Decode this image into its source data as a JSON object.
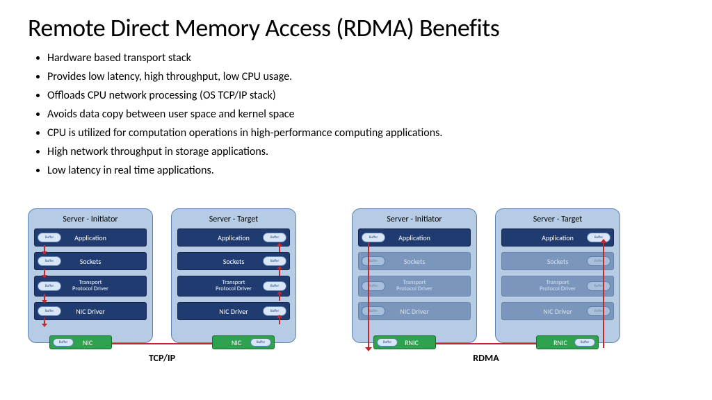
{
  "title": "Remote Direct Memory Access (RDMA) Benefits",
  "bullets": [
    "Hardware based transport stack",
    "Provides low latency, high throughput, low CPU usage.",
    "Offloads CPU network processing (OS TCP/IP stack)",
    "Avoids data copy between user space and kernel space",
    "CPU is utilized for computation operations in high-performance computing applications.",
    "High network throughput in storage applications.",
    "Low latency in real time applications."
  ],
  "buffer_label": "Buffer",
  "servers": {
    "initiator": "Server - Initiator",
    "target": "Server - Target"
  },
  "layers": {
    "app": "Application",
    "sockets": "Sockets",
    "transport": "Transport Protocol Driver",
    "nicdrv": "NIC Driver"
  },
  "nic": {
    "tcp": "NIC",
    "rdma": "RNIC"
  },
  "protocol": {
    "tcp": "TCP/IP",
    "rdma": "RDMA"
  }
}
